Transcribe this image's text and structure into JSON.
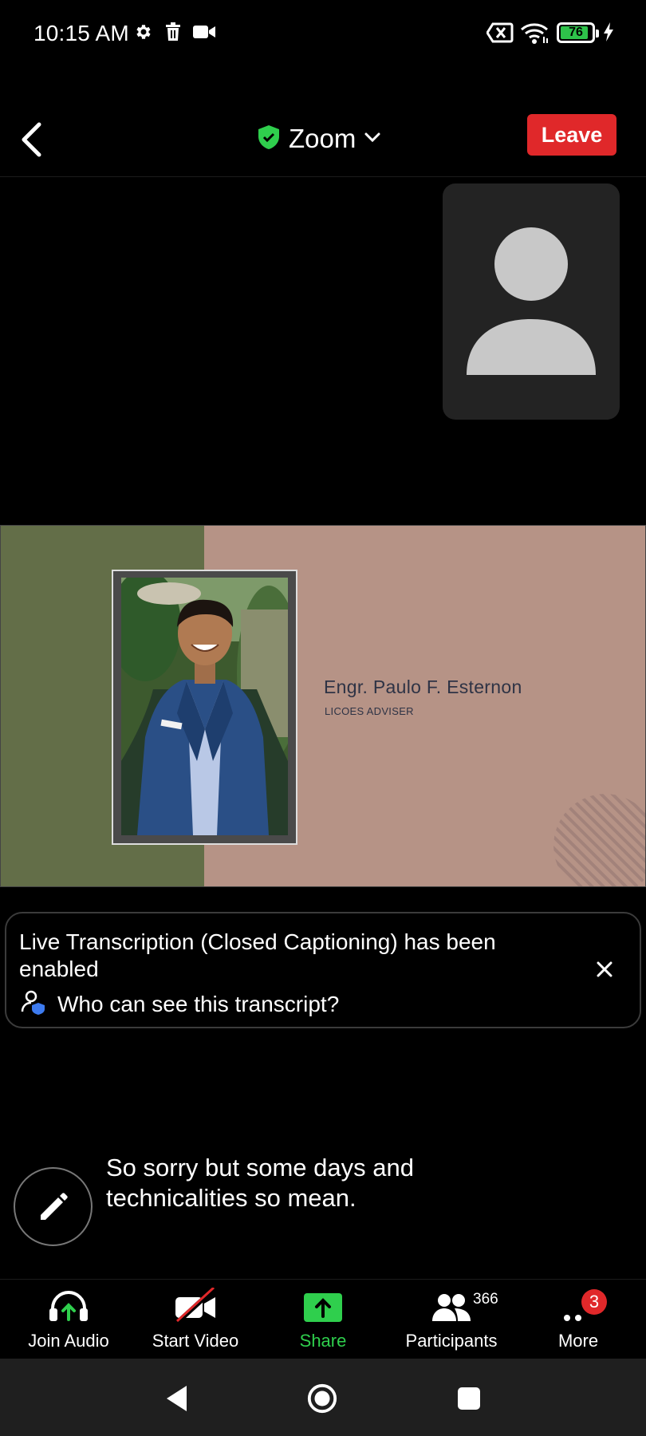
{
  "status_bar": {
    "time": "10:15 AM",
    "icons": [
      "gear-icon",
      "trash-icon",
      "video-camera-icon",
      "no-sim-icon",
      "wifi-icon",
      "charging-bolt-icon"
    ],
    "battery": "76"
  },
  "header": {
    "title": "Zoom",
    "leave_label": "Leave",
    "colors": {
      "leave": "#e0282a",
      "secure": "#2fcf4d"
    }
  },
  "shared_screen": {
    "presenter_name": "Engr. Paulo F. Esternon",
    "presenter_role": "LICOES ADVISER",
    "colors": {
      "left_panel": "#636e48",
      "right_panel": "#b69386"
    }
  },
  "transcript_notice": {
    "message": "Live Transcription (Closed Captioning) has been enabled",
    "link": "Who can see this transcript?"
  },
  "caption": {
    "text": "So sorry but some days and technicalities so mean."
  },
  "toolbar": {
    "join_audio": "Join Audio",
    "start_video": "Start Video",
    "share": "Share",
    "participants": "Participants",
    "participants_count": "366",
    "more": "More",
    "more_badge": "3"
  }
}
